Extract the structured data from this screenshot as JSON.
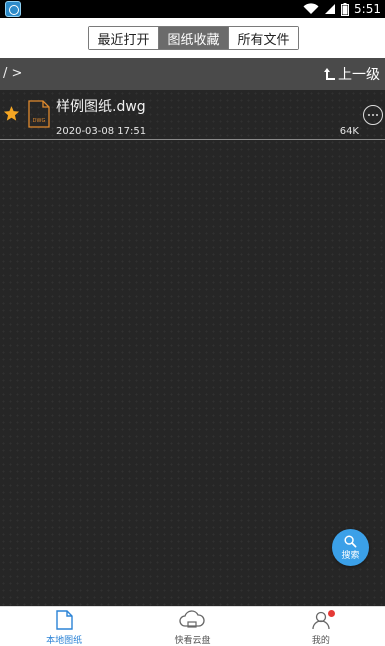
{
  "status_bar": {
    "time": "5:51",
    "icons": [
      "app-notification-icon",
      "wifi-icon",
      "signal-icon",
      "battery-icon"
    ]
  },
  "tabs": [
    {
      "label": "最近打开",
      "active": false
    },
    {
      "label": "图纸收藏",
      "active": true
    },
    {
      "label": "所有文件",
      "active": false
    }
  ],
  "path_bar": {
    "breadcrumb": "/ >",
    "up_label": "上一级"
  },
  "files": [
    {
      "name": "样例图纸.dwg",
      "type_label": "DWG",
      "date": "2020-03-08 17:51",
      "size": "64K",
      "starred": true
    }
  ],
  "fab": {
    "label": "搜索"
  },
  "bottom_nav": [
    {
      "label": "本地图纸",
      "icon": "document-icon",
      "active": true
    },
    {
      "label": "快看云盘",
      "icon": "cloud-icon",
      "active": false
    },
    {
      "label": "我的",
      "icon": "user-icon",
      "active": false,
      "badge": true
    }
  ],
  "colors": {
    "accent": "#3ba0e8",
    "active_nav": "#2b83d6",
    "star": "#f5a623",
    "file_icon": "#e08a2e",
    "badge": "#e53935",
    "active_tab_bg": "#6b6b6b",
    "path_bar_bg": "#4a4a4a",
    "list_bg": "#262626"
  }
}
